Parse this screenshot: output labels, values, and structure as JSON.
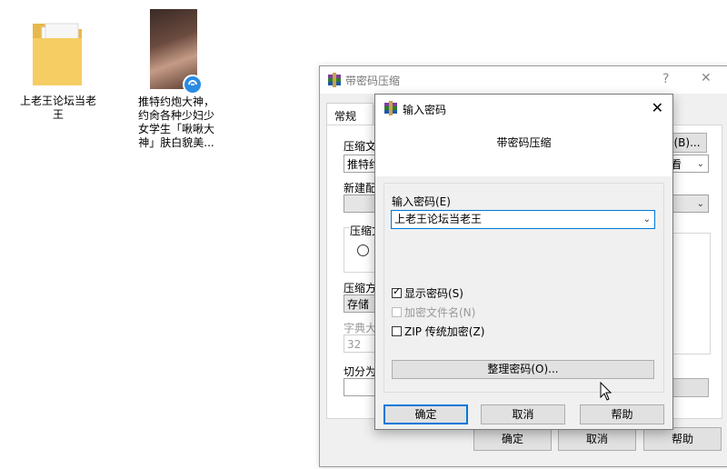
{
  "desktop": {
    "folder_label": "上老王论坛当老王",
    "video_label_lines": [
      "推特约炮大神，",
      "约肏各种少妇少",
      "女学生「啾啾大",
      "神」肤白貌美..."
    ]
  },
  "back_window": {
    "title": "带密码压缩",
    "help_glyph": "?",
    "close_glyph": "✕",
    "tab_general": "常规",
    "archive_name_label": "压缩文",
    "archive_name_value": "推特约",
    "browse_button": "(B)...",
    "format_partial": "看",
    "profile_label": "新建配",
    "archive_format_label": "压缩文",
    "compress_method_label": "压缩方",
    "compress_method_value": "存储",
    "dict_size_label": "字典大",
    "dict_size_value": "32",
    "split_label": "切分为",
    "ok_button": "确定",
    "cancel_button": "取消",
    "help_button": "帮助"
  },
  "dialog": {
    "title": "输入密码",
    "close_glyph": "✕",
    "header": "带密码压缩",
    "password_label": "输入密码(E)",
    "password_value": "上老王论坛当老王",
    "show_password": "显示密码(S)",
    "encrypt_filenames": "加密文件名(N)",
    "zip_legacy": "ZIP 传统加密(Z)",
    "organize_button": "整理密码(O)...",
    "ok_button": "确定",
    "cancel_button": "取消",
    "help_button": "帮助",
    "show_password_checked": true,
    "encrypt_filenames_checked": false,
    "zip_legacy_checked": false
  }
}
